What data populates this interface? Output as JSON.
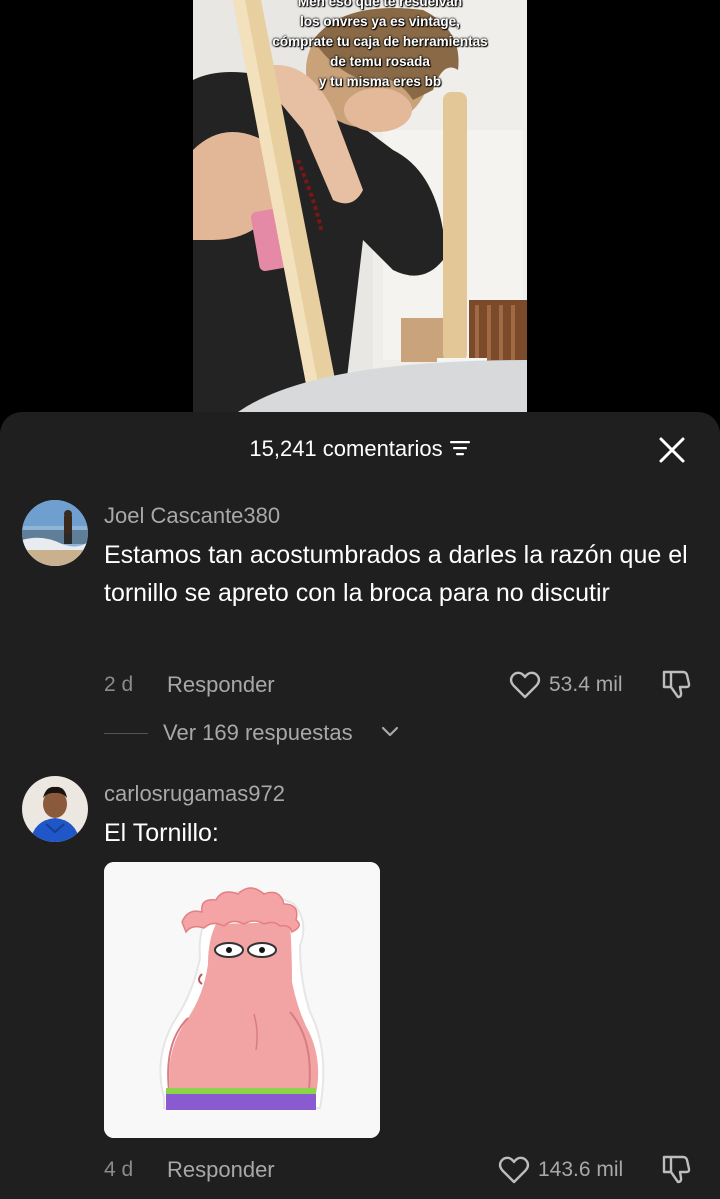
{
  "video": {
    "overlay_lines": [
      "Men eso que te resuelvan",
      "los onvres ya es vintage,",
      "cómprate tu caja de herramientas",
      "de temu rosada",
      "y tu misma eres bb"
    ]
  },
  "comments_sheet": {
    "count_label": "15,241 comentarios",
    "comments": [
      {
        "username": "Joel Cascante380",
        "text": "Estamos tan acostumbrados a darles la razón que el tornillo se apreto con la broca para no discutir",
        "time": "2 d",
        "reply_label": "Responder",
        "likes": "53.4 mil",
        "replies_label": "Ver 169 respuestas"
      },
      {
        "username": "carlosrugamas972",
        "text": "El Tornillo:",
        "time": "4 d",
        "reply_label": "Responder",
        "likes": "143.6 mil"
      }
    ]
  },
  "colors": {
    "sheet_bg": "#1f1f1f",
    "muted_text": "#a8a8a8",
    "sticker_pink": "#f2a3a3"
  },
  "icons": [
    "filter-icon",
    "close-icon",
    "heart-icon",
    "dislike-icon",
    "chevron-down-icon"
  ]
}
